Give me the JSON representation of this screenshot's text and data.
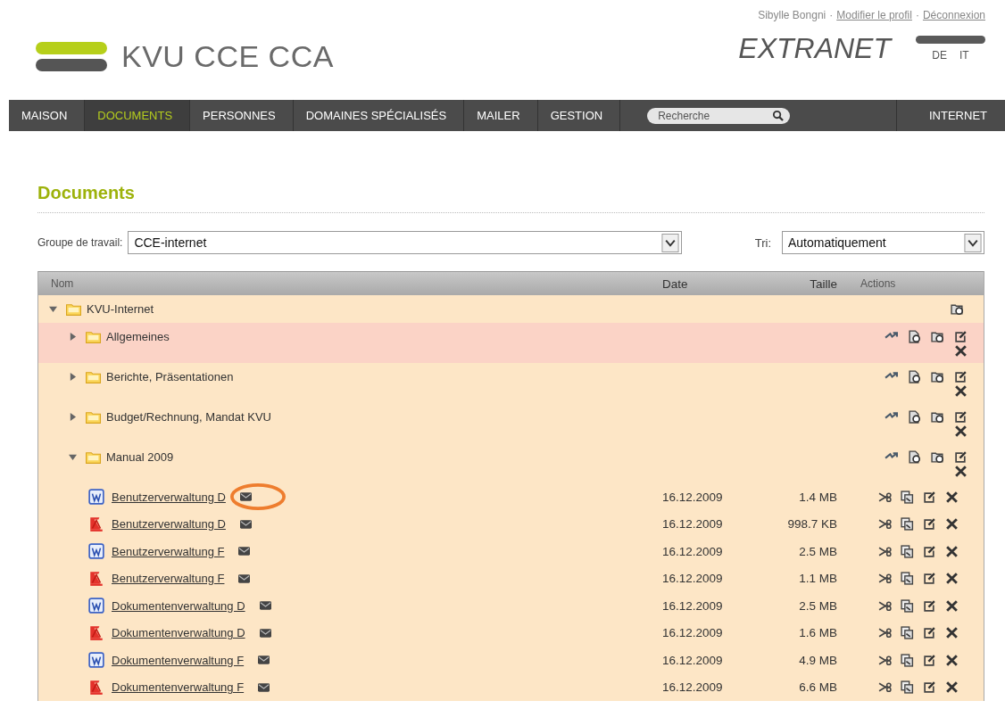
{
  "user": {
    "name": "Sibylle Bongni",
    "separator": "·",
    "links": [
      "Modifier le profil",
      "Déconnexion"
    ]
  },
  "logo": {
    "text": "KVU CCE CCA"
  },
  "brand": "EXTRANET",
  "languages": [
    "DE",
    "IT"
  ],
  "nav": [
    {
      "label": "MAISON",
      "selected": false
    },
    {
      "label": "DOCUMENTS",
      "selected": true
    },
    {
      "label": "PERSONNES",
      "selected": false
    },
    {
      "label": "DOMAINES SPÉCIALISÉS",
      "selected": false
    },
    {
      "label": "MAILER",
      "selected": false
    },
    {
      "label": "GESTION",
      "selected": false
    }
  ],
  "search": {
    "placeholder": "Recherche"
  },
  "nav_right": "INTERNET",
  "page_title": "Documents",
  "filters": {
    "group_label": "Groupe de travail:",
    "group_value": "CCE-internet",
    "sort_label": "Tri:",
    "sort_value": "Automatiquement"
  },
  "table": {
    "columns": [
      "Nom",
      "Date",
      "Taille",
      "Actions"
    ],
    "tree": [
      {
        "kind": "root",
        "name": "KVU-Internet",
        "expanded": true,
        "selected": false,
        "children": [
          {
            "kind": "folder",
            "name": "Allgemeines",
            "expanded": false,
            "selected": true
          },
          {
            "kind": "folder",
            "name": "Berichte, Präsentationen",
            "expanded": false,
            "selected": false
          },
          {
            "kind": "folder",
            "name": "Budget/Rechnung, Mandat KVU",
            "expanded": false,
            "selected": false
          },
          {
            "kind": "folder",
            "name": "Manual 2009",
            "expanded": true,
            "selected": false,
            "children": [
              {
                "kind": "word",
                "name": "Benutzerverwaltung D",
                "date": "16.12.2009",
                "size": "1.4 MB",
                "circled": true
              },
              {
                "kind": "pdf",
                "name": "Benutzerverwaltung D",
                "date": "16.12.2009",
                "size": "998.7 KB",
                "circled": false
              },
              {
                "kind": "word",
                "name": "Benutzerverwaltung F",
                "date": "16.12.2009",
                "size": "2.5 MB",
                "circled": false
              },
              {
                "kind": "pdf",
                "name": "Benutzerverwaltung F",
                "date": "16.12.2009",
                "size": "1.1 MB",
                "circled": false
              },
              {
                "kind": "word",
                "name": "Dokumentenverwaltung D",
                "date": "16.12.2009",
                "size": "2.5 MB",
                "circled": false
              },
              {
                "kind": "pdf",
                "name": "Dokumentenverwaltung D",
                "date": "16.12.2009",
                "size": "1.6 MB",
                "circled": false
              },
              {
                "kind": "word",
                "name": "Dokumentenverwaltung F",
                "date": "16.12.2009",
                "size": "4.9 MB",
                "circled": false
              },
              {
                "kind": "pdf",
                "name": "Dokumentenverwaltung F",
                "date": "16.12.2009",
                "size": "6.6 MB",
                "circled": false
              }
            ]
          }
        ]
      }
    ]
  }
}
